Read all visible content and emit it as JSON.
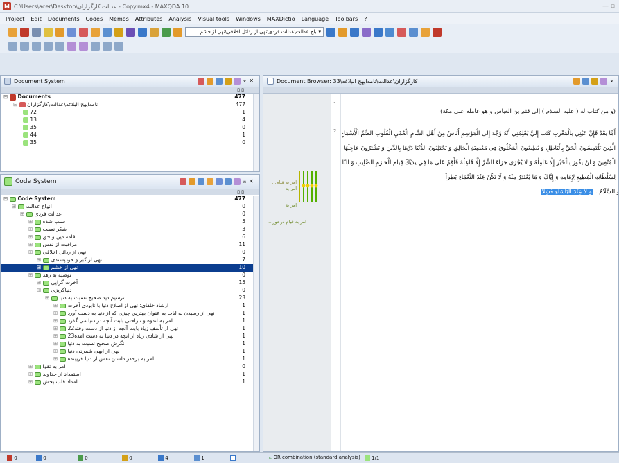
{
  "window": {
    "title": "C:\\Users\\acer\\Desktop\\عدالت کارگزاران - Copy.mx4 - MAXQDA 10"
  },
  "menu": [
    "Project",
    "Edit",
    "Documents",
    "Codes",
    "Memos",
    "Attributes",
    "Analysis",
    "Visual tools",
    "Windows",
    "MAXDictio",
    "Language",
    "Toolbars",
    "?"
  ],
  "toolbar": {
    "combo_value": "باخ عدالت\\عدالت فردی\\نهی از رذائل اخلاقی\\نهی از خشم"
  },
  "doc_system": {
    "title": "Document System",
    "col_count": "477",
    "root": {
      "label": "Documents",
      "count": "477"
    },
    "group": {
      "label": "نامه‌ایهج البلاغه\\عدالت\\کارگزاران",
      "count": "477"
    },
    "docs": [
      {
        "label": "72",
        "count": "1"
      },
      {
        "label": "13",
        "count": "4"
      },
      {
        "label": "35",
        "count": "0"
      },
      {
        "label": "44",
        "count": "1"
      },
      {
        "label": "35",
        "count": "0"
      }
    ]
  },
  "code_system": {
    "title": "Code System",
    "root": {
      "label": "Code System",
      "count": "477"
    },
    "items": [
      {
        "label": "انواع عدالت",
        "count": "0",
        "indent": 1
      },
      {
        "label": "عدالت فردی",
        "count": "0",
        "indent": 2
      },
      {
        "label": "سبب شده",
        "count": "5",
        "indent": 3
      },
      {
        "label": "شکر نعمت",
        "count": "3",
        "indent": 3
      },
      {
        "label": "اقامه دین و حق",
        "count": "6",
        "indent": 3
      },
      {
        "label": "مراقبت از نفس",
        "count": "11",
        "indent": 3
      },
      {
        "label": "نهی از رذائل اخلاقی",
        "count": "0",
        "indent": 3
      },
      {
        "label": "نهی از کبر و خودپسندی",
        "count": "7",
        "indent": 4
      },
      {
        "label": "نهی از خشم",
        "count": "10",
        "indent": 4,
        "selected": true
      },
      {
        "label": "توصیه به زهد",
        "count": "0",
        "indent": 3
      },
      {
        "label": "آخرت گرایی",
        "count": "15",
        "indent": 4
      },
      {
        "label": "دنیاگریزی",
        "count": "0",
        "indent": 4
      },
      {
        "label": "ترسیم دید صحیح نسبت به دنیا",
        "count": "23",
        "indent": 5
      },
      {
        "label": "ارشاد خلفای: نهی از اصلاح دنیا با نابودی آخرت",
        "count": "1",
        "indent": 6
      },
      {
        "label": "نهی از رسیدن به لذت به عنوان بهترین چیزی که از دنیا به دست آورد",
        "count": "1",
        "indent": 6
      },
      {
        "label": "امر به اندوه و ناراحتی بابت آنچه در دنیا می گذرد",
        "count": "1",
        "indent": 6
      },
      {
        "label": "نهی از تأسف زیاد بابت آنچه از دنیا از دست رفته22",
        "count": "1",
        "indent": 6
      },
      {
        "label": "نهی از شادی زیاد از آنچه در دنیا به دست آمده23",
        "count": "1",
        "indent": 6
      },
      {
        "label": "نگرش صحیح نسبت به دنیا",
        "count": "1",
        "indent": 6
      },
      {
        "label": "نهی از ابهی شمردن دنیا",
        "count": "1",
        "indent": 6
      },
      {
        "label": "امر به برحذر داشتن نفس از دنیا فریبنده",
        "count": "1",
        "indent": 6
      },
      {
        "label": "امر به تقوا",
        "count": "0",
        "indent": 3
      },
      {
        "label": "استمداد از خداوند",
        "count": "1",
        "indent": 3
      },
      {
        "label": "امداد قلب بخش",
        "count": "1",
        "indent": 3
      }
    ]
  },
  "doc_browser": {
    "title": "Document Browser: 33\\کارگزاران\\عدالت\\نامه‌ایهج البلاغه",
    "para1_num": "1",
    "para1": "(و من كتاب له ( عليه السلام ) إلى قثم بن العباس و هو عامله على مكة)",
    "para2_num": "2",
    "lines": [
      "أَمَّا بَعْدُ فَإِنَّ عَيْنِي بِالْمَغْرِبِ كَتَبَ إِلَيَّ يُعْلِمُنِي أَنَّهُ وُجِّهَ إِلَى الْمَوْسِمِ أُنَاسٌ مِنْ أَهْلِ الشَّامِ الْعُمْيِ الْقُلُوبِ الصُّمِّ الْأَسْمَاعِ الْكُمْهِ الْأَبْصَارِ",
      "الَّذِينَ يَلْتَمِسُونَ الْحَقَّ بِالْبَاطِلِ وَ يُطِيعُونَ الْمَخْلُوقَ فِي مَعْصِيَةِ الْخَالِقِ وَ يَحْتَلِبُونَ الدُّنْيَا دَرَّهَا بِالدِّينِ وَ يَشْتَرُونَ عَاجِلَهَا بِآجِلِ الْأَبْرَارِ",
      "الْمُتَّقِينَ وَ لَنْ يَفُوزَ بِالْخَيْرِ إِلَّا عَامِلُهُ وَ لَا يُجْزَى جَزَاءَ الشَّرِّ إِلَّا فَاعِلُهُ فَأَقِمْ عَلَى مَا فِي يَدَيْكَ قِيَامَ الْحَازِمِ الصَّلِيبِ وَ النَّاصِحِ اللَّبِيبِ التَّابِعِ",
      "لِسُلْطَانِهِ الْمُطِيعِ لِإِمَامِهِ وَ إِيَّاكَ وَ مَا يُعْتَذَرُ مِنْهُ وَ لَا تَكُنْ عِنْدَ النَّعْمَاءِ بَطِراً"
    ],
    "highlight": "وَ لَا عِنْدَ الْبَأْسَاءِ فَشِلًا",
    "tail": "وَ السَّلَامُ .",
    "margin_codes": [
      {
        "label": "امر به قیام...",
        "color": "#8a8a3a"
      },
      {
        "label": "امر به",
        "color": "#8a8a3a"
      },
      {
        "label": "امر به",
        "color": "#8a8a3a"
      },
      {
        "label": "امر به قیام در دور...",
        "color": "#8a8a3a"
      }
    ]
  },
  "status": {
    "items": [
      "0",
      "0",
      "0",
      "0",
      "4",
      "1",
      "1"
    ],
    "combination": "OR combination (standard analysis)",
    "page": "1/1"
  }
}
